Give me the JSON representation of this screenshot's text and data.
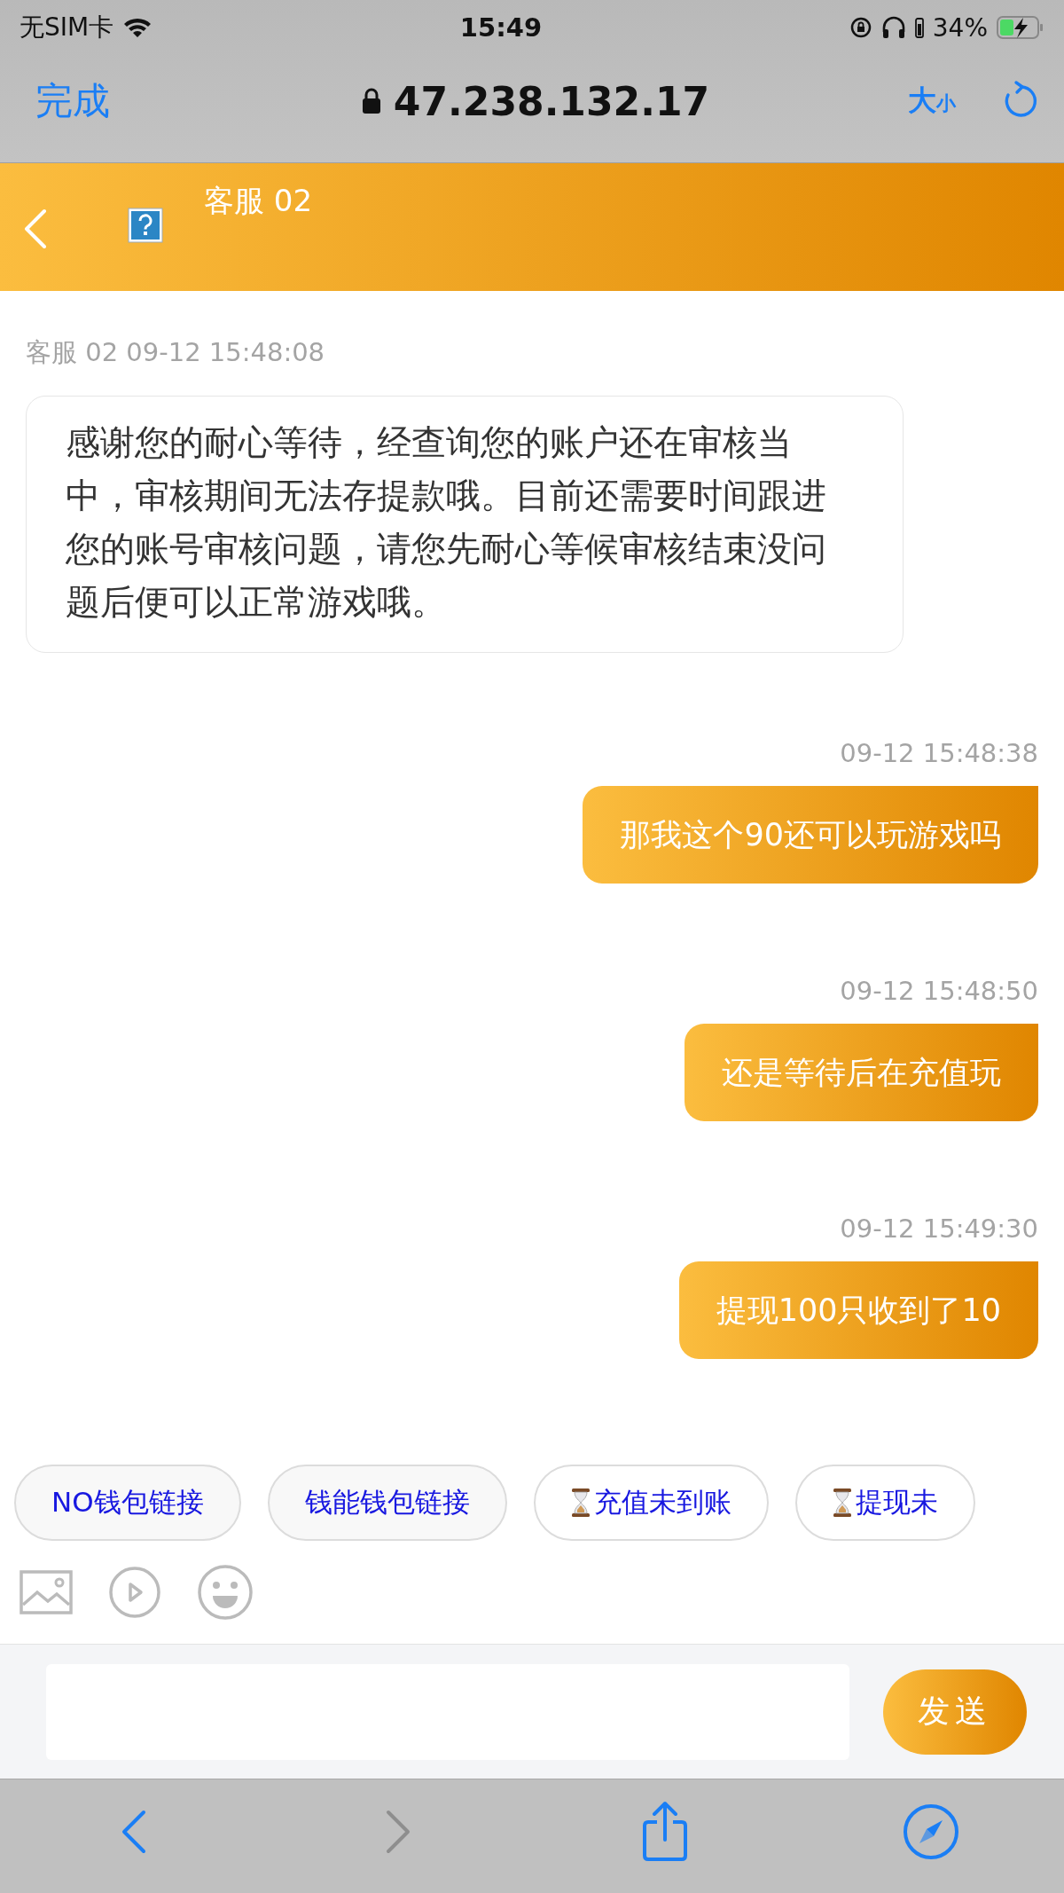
{
  "status_bar": {
    "carrier": "无SIM卡",
    "time": "15:49",
    "battery": "34%",
    "charging": true
  },
  "browser_bar": {
    "done": "完成",
    "secure": true,
    "address": "47.238.132.17",
    "text_size_large": "大",
    "text_size_small": "小"
  },
  "chat_header": {
    "title": "客服 02"
  },
  "messages": [
    {
      "kind": "agent",
      "meta": "客服 02 09-12 15:48:08",
      "text": "感谢您的耐心等待，经查询您的账户还在审核当中，审核期间无法存提款哦。目前还需要时间跟进您的账号审核问题，请您先耐心等候审核结束没问题后便可以正常游戏哦。"
    },
    {
      "kind": "user",
      "meta": "09-12 15:48:38",
      "text": "那我这个90还可以玩游戏吗"
    },
    {
      "kind": "user",
      "meta": "09-12 15:48:50",
      "text": "还是等待后在充值玩"
    },
    {
      "kind": "user",
      "meta": "09-12 15:49:30",
      "text": "提现100只收到了10"
    }
  ],
  "quick_replies": [
    {
      "kind": "plain",
      "label": "NO钱包链接"
    },
    {
      "kind": "plain",
      "label": "钱能钱包链接"
    },
    {
      "kind": "hourglass",
      "label": "充值未到账"
    },
    {
      "kind": "hourglass",
      "label": "提现未"
    }
  ],
  "composer": {
    "send": "发送"
  },
  "toolbar": [
    {
      "kind": "back",
      "disabled": false
    },
    {
      "kind": "forward",
      "disabled": true
    },
    {
      "kind": "share",
      "disabled": false
    },
    {
      "kind": "compass",
      "disabled": false
    }
  ]
}
